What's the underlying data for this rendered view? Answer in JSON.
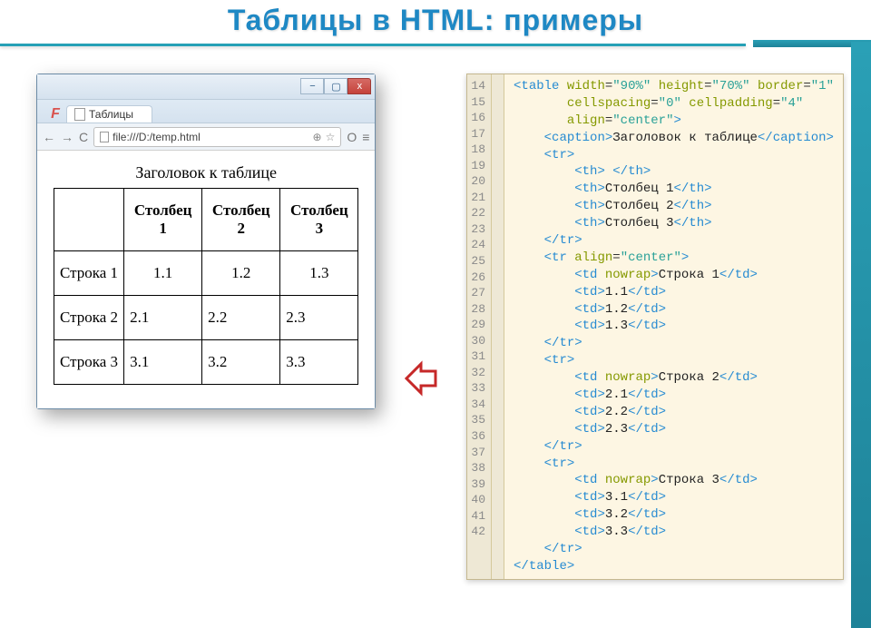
{
  "title": "Таблицы в HTML: примеры",
  "browser": {
    "win_min": "−",
    "win_max": "▢",
    "win_close": "x",
    "tab_label": "Таблицы",
    "nav_back": "←",
    "nav_fwd": "→",
    "nav_reload": "C",
    "url": "file:///D:/temp.html",
    "addr_right1": "⊕",
    "addr_right2": "☆",
    "menu_icon": "≡",
    "o_icon": "O",
    "f_logo": "F"
  },
  "table": {
    "caption": "Заголовок к таблице",
    "headers": [
      "",
      "Столбец 1",
      "Столбец 2",
      "Столбец 3"
    ],
    "rows": [
      {
        "label": "Строка 1",
        "cells": [
          "1.1",
          "1.2",
          "1.3"
        ],
        "centered": true
      },
      {
        "label": "Строка 2",
        "cells": [
          "2.1",
          "2.2",
          "2.3"
        ],
        "centered": false
      },
      {
        "label": "Строка 3",
        "cells": [
          "3.1",
          "3.2",
          "3.3"
        ],
        "centered": false
      }
    ]
  },
  "code_lines": [
    {
      "n": 14,
      "html": "<span class='tag'>&lt;table</span> <span class='attr'>width</span>=<span class='val'>\"90%\"</span> <span class='attr'>height</span>=<span class='val'>\"70%\"</span> <span class='attr'>border</span>=<span class='val'>\"1\"</span>"
    },
    {
      "n": 15,
      "html": "       <span class='attr'>cellspacing</span>=<span class='val'>\"0\"</span> <span class='attr'>cellpadding</span>=<span class='val'>\"4\"</span>"
    },
    {
      "n": 16,
      "html": "       <span class='attr'>align</span>=<span class='val'>\"center\"</span><span class='tag'>&gt;</span>"
    },
    {
      "n": 17,
      "html": "    <span class='tag'>&lt;caption&gt;</span><span class='txt'>Заголовок к таблице</span><span class='tag'>&lt;/caption&gt;</span>"
    },
    {
      "n": 18,
      "html": "    <span class='tag'>&lt;tr&gt;</span>"
    },
    {
      "n": 19,
      "html": "        <span class='tag'>&lt;th&gt;</span> <span class='tag'>&lt;/th&gt;</span>"
    },
    {
      "n": 20,
      "html": "        <span class='tag'>&lt;th&gt;</span><span class='txt'>Столбец 1</span><span class='tag'>&lt;/th&gt;</span>"
    },
    {
      "n": 21,
      "html": "        <span class='tag'>&lt;th&gt;</span><span class='txt'>Столбец 2</span><span class='tag'>&lt;/th&gt;</span>"
    },
    {
      "n": 22,
      "html": "        <span class='tag'>&lt;th&gt;</span><span class='txt'>Столбец 3</span><span class='tag'>&lt;/th&gt;</span>"
    },
    {
      "n": 23,
      "html": "    <span class='tag'>&lt;/tr&gt;</span>"
    },
    {
      "n": 24,
      "html": "    <span class='tag'>&lt;tr</span> <span class='attr'>align</span>=<span class='val'>\"center\"</span><span class='tag'>&gt;</span>"
    },
    {
      "n": 25,
      "html": "        <span class='tag'>&lt;td</span> <span class='attr'>nowrap</span><span class='tag'>&gt;</span><span class='txt'>Строка 1</span><span class='tag'>&lt;/td&gt;</span>"
    },
    {
      "n": 26,
      "html": "        <span class='tag'>&lt;td&gt;</span><span class='txt'>1.1</span><span class='tag'>&lt;/td&gt;</span>"
    },
    {
      "n": 27,
      "html": "        <span class='tag'>&lt;td&gt;</span><span class='txt'>1.2</span><span class='tag'>&lt;/td&gt;</span>"
    },
    {
      "n": 28,
      "html": "        <span class='tag'>&lt;td&gt;</span><span class='txt'>1.3</span><span class='tag'>&lt;/td&gt;</span>"
    },
    {
      "n": 29,
      "html": "    <span class='tag'>&lt;/tr&gt;</span>"
    },
    {
      "n": 30,
      "html": "    <span class='tag'>&lt;tr&gt;</span>"
    },
    {
      "n": 31,
      "html": "        <span class='tag'>&lt;td</span> <span class='attr'>nowrap</span><span class='tag'>&gt;</span><span class='txt'>Строка 2</span><span class='tag'>&lt;/td&gt;</span>"
    },
    {
      "n": 32,
      "html": "        <span class='tag'>&lt;td&gt;</span><span class='txt'>2.1</span><span class='tag'>&lt;/td&gt;</span>"
    },
    {
      "n": 33,
      "html": "        <span class='tag'>&lt;td&gt;</span><span class='txt'>2.2</span><span class='tag'>&lt;/td&gt;</span>"
    },
    {
      "n": 34,
      "html": "        <span class='tag'>&lt;td&gt;</span><span class='txt'>2.3</span><span class='tag'>&lt;/td&gt;</span>"
    },
    {
      "n": 35,
      "html": "    <span class='tag'>&lt;/tr&gt;</span>"
    },
    {
      "n": 36,
      "html": "    <span class='tag'>&lt;tr&gt;</span>"
    },
    {
      "n": 37,
      "html": "        <span class='tag'>&lt;td</span> <span class='attr'>nowrap</span><span class='tag'>&gt;</span><span class='txt'>Строка 3</span><span class='tag'>&lt;/td&gt;</span>"
    },
    {
      "n": 38,
      "html": "        <span class='tag'>&lt;td&gt;</span><span class='txt'>3.1</span><span class='tag'>&lt;/td&gt;</span>"
    },
    {
      "n": 39,
      "html": "        <span class='tag'>&lt;td&gt;</span><span class='txt'>3.2</span><span class='tag'>&lt;/td&gt;</span>"
    },
    {
      "n": 40,
      "html": "        <span class='tag'>&lt;td&gt;</span><span class='txt'>3.3</span><span class='tag'>&lt;/td&gt;</span>"
    },
    {
      "n": 41,
      "html": "    <span class='tag'>&lt;/tr&gt;</span>"
    },
    {
      "n": 42,
      "html": "<span class='tag'>&lt;/table&gt;</span>"
    }
  ]
}
